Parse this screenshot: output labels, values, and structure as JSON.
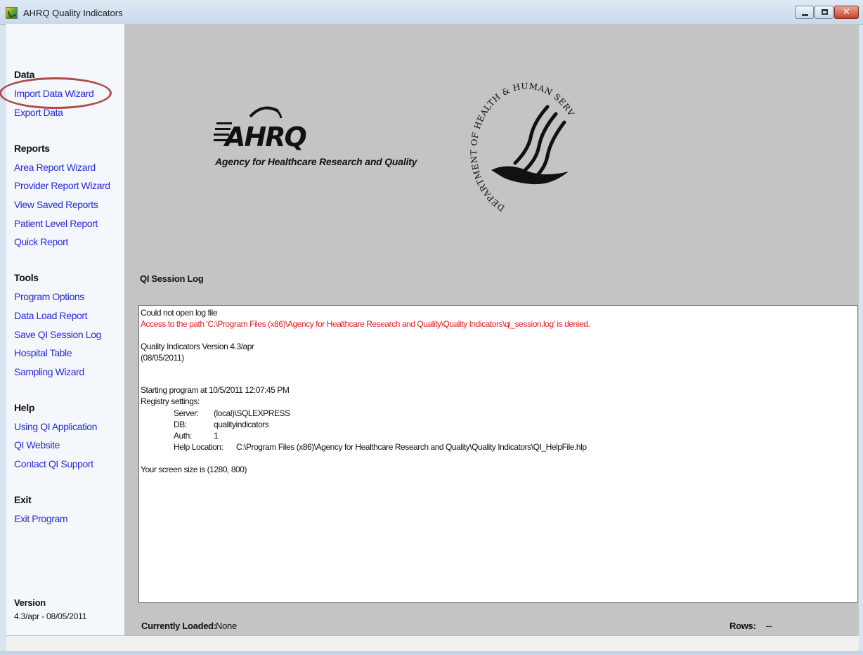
{
  "window": {
    "title": "AHRQ Quality Indicators"
  },
  "sidebar": {
    "sections": [
      {
        "heading": "Data",
        "links": [
          "Import Data Wizard",
          "Export Data"
        ]
      },
      {
        "heading": "Reports",
        "links": [
          "Area Report Wizard",
          "Provider Report Wizard",
          "View Saved Reports",
          "Patient Level Report",
          "Quick Report"
        ]
      },
      {
        "heading": "Tools",
        "links": [
          "Program Options",
          "Data Load Report",
          "Save QI Session Log",
          "Hospital Table",
          "Sampling Wizard"
        ]
      },
      {
        "heading": "Help",
        "links": [
          "Using QI Application",
          "QI Website",
          "Contact QI Support"
        ]
      },
      {
        "heading": "Exit",
        "links": [
          "Exit Program"
        ]
      }
    ],
    "version_heading": "Version",
    "version_value": "4.3/apr - 08/05/2011",
    "highlighted_link": "Import Data Wizard"
  },
  "branding": {
    "ahrq_wordmark": "AHRQ",
    "ahrq_tagline": "Agency for Healthcare Research and Quality",
    "hhs_seal_text": "DEPARTMENT OF HEALTH & HUMAN SERVICES·USA"
  },
  "log": {
    "title": "QI Session Log",
    "lines": {
      "l1": "Could not open log file",
      "l2": "Access to the path 'C:\\Program Files (x86)\\Agency for Healthcare Research and Quality\\Quality Indicators\\qi_session.log' is denied.",
      "l3": "Quality Indicators Version 4.3/apr",
      "l4": "(08/05/2011)",
      "l5": "Starting program at 10/5/2011 12:07:45 PM",
      "l6": "Registry settings:",
      "server_key": "Server:",
      "server_val": "(local)\\SQLEXPRESS",
      "db_key": "DB:",
      "db_val": "qualityindicators",
      "auth_key": "Auth:",
      "auth_val": "1",
      "help_key": "Help Location:",
      "help_val": "C:\\Program Files (x86)\\Agency for Healthcare Research and Quality\\Quality Indicators\\QI_HelpFile.hlp",
      "l7": "Your screen size is (1280, 800)"
    }
  },
  "status": {
    "loaded_label": "Currently Loaded:",
    "loaded_value": "None",
    "rows_label": "Rows:",
    "rows_value": "--"
  },
  "colors": {
    "link": "#2a2ad6",
    "error_text": "#e02020",
    "highlight_ring": "#b24a4a",
    "main_bg": "#c4c4c4",
    "sidebar_bg": "#f4f8fd"
  }
}
